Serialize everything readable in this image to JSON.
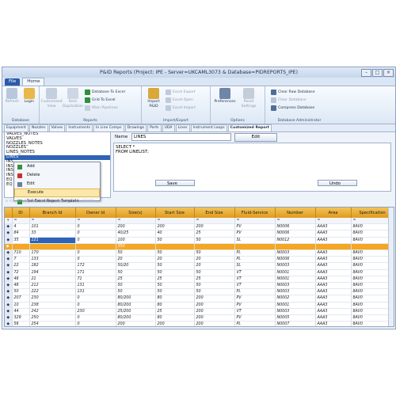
{
  "window": {
    "title": "P&ID Reports (Project: IPE - Server=UKCAML3073 & Database=PIDREPORTS_IPE)"
  },
  "menu_tabs": [
    "File",
    "Home"
  ],
  "ribbon": {
    "database": {
      "label": "Database",
      "refresh": "Refresh",
      "login": "Login"
    },
    "reports": {
      "label": "Reports",
      "customized_view": "Customized View",
      "item_duplication": "Item Duplication",
      "database_to_excel": "Database To Excel",
      "grid_to_excel": "Grid To Excel",
      "main_pipelines": "Main Pipelines"
    },
    "import_export": {
      "label": "Import/Export",
      "import_pid": "Import P&ID",
      "excel_export": "Excel Export",
      "excel_open": "Excel Open",
      "excel_import": "Excel Import"
    },
    "options": {
      "label": "Options",
      "preferences": "Preferences",
      "reset_settings": "Reset Settings"
    },
    "db_admin": {
      "label": "Database Administrator",
      "clear_raw_database": "Clear Raw Database",
      "clear_database": "Clear Database",
      "compress_database": "Compress Database"
    }
  },
  "content_tabs": [
    "Equipment",
    "Nozzles",
    "Valves",
    "Instruments",
    "In Line Comps",
    "Drawings",
    "Ports",
    "UDA",
    "Lines",
    "Instrument Loops",
    "Customized Report"
  ],
  "report_list": [
    "VALVES_NOTES",
    "VALVES",
    "NOZZLES_NOTES",
    "NOZZLES",
    "LINES_NOTES",
    "LINES",
    "INS",
    "INS",
    "INS",
    "INS",
    "EQ",
    "EQ"
  ],
  "context_menu": [
    "Add",
    "Delete",
    "Edit",
    "Execute",
    "Set Excel Report Template"
  ],
  "name_label": "Name",
  "name_value": "LINES",
  "edit_button": "Edit",
  "sql_text": [
    "SELECT *",
    "FROM LINELIST;"
  ],
  "save_button": "Save",
  "undo_button": "Undo",
  "group_hint": "a column header here to group by that column.",
  "grid": {
    "columns": [
      "ID",
      "Branch Id",
      "Owner Id",
      "Size(s)",
      "Start Size",
      "End Size",
      "Fluid-Service",
      "Number",
      "Area",
      "Specification"
    ],
    "filter_row": [
      "=",
      "=",
      "=",
      "=",
      "=",
      "=",
      "=",
      "=",
      "=",
      "="
    ],
    "rows": [
      [
        "4",
        "101",
        "0",
        "200",
        "200",
        "200",
        "PV",
        "N0006",
        "AAA3",
        "8AV0"
      ],
      [
        "84",
        "33",
        "0",
        "40/25",
        "40",
        "25",
        "PV",
        "N0006",
        "AAA3",
        "8AV0"
      ],
      [
        "35",
        "121",
        "0",
        "100",
        "50",
        "50",
        "SL",
        "N0012",
        "AAA3",
        "8AV0"
      ],
      [
        "",
        "",
        "",
        "350",
        "",
        "",
        "",
        "",
        "",
        ""
      ],
      [
        "710",
        "170",
        "0",
        "50",
        "50",
        "50",
        "PL",
        "N0003",
        "AAA3",
        "8AV0"
      ],
      [
        "7",
        "133",
        "0",
        "20",
        "20",
        "20",
        "PL",
        "N0006",
        "AAA3",
        "8AV0"
      ],
      [
        "22",
        "182",
        "172",
        "50/20",
        "50",
        "20",
        "SL",
        "N0003",
        "AAA3",
        "8AV0"
      ],
      [
        "72",
        "194",
        "171",
        "50",
        "50",
        "50",
        "VT",
        "N0001",
        "AAA3",
        "8AV0"
      ],
      [
        "46",
        "21",
        "71",
        "25",
        "25",
        "25",
        "VT",
        "N0001",
        "AAA3",
        "8AV0"
      ],
      [
        "48",
        "212",
        "131",
        "50",
        "50",
        "50",
        "VT",
        "N0003",
        "AAA3",
        "8AV0"
      ],
      [
        "50",
        "222",
        "131",
        "50",
        "50",
        "50",
        "PL",
        "N0003",
        "AAA3",
        "8AV0"
      ],
      [
        "207",
        "230",
        "0",
        "80/200",
        "80",
        "200",
        "PV",
        "N0002",
        "AAA3",
        "8AV0"
      ],
      [
        "10",
        "238",
        "0",
        "80/200",
        "80",
        "200",
        "PV",
        "N0001",
        "AAA3",
        "8AV0"
      ],
      [
        "44",
        "242",
        "230",
        "25/200",
        "25",
        "200",
        "VT",
        "N0003",
        "AAA3",
        "8AV0"
      ],
      [
        "329",
        "250",
        "0",
        "80/200",
        "80",
        "200",
        "PV",
        "N0005",
        "AAA3",
        "8AV0"
      ],
      [
        "56",
        "254",
        "0",
        "200",
        "200",
        "200",
        "PL",
        "N0007",
        "AAA3",
        "8AV0"
      ]
    ]
  }
}
